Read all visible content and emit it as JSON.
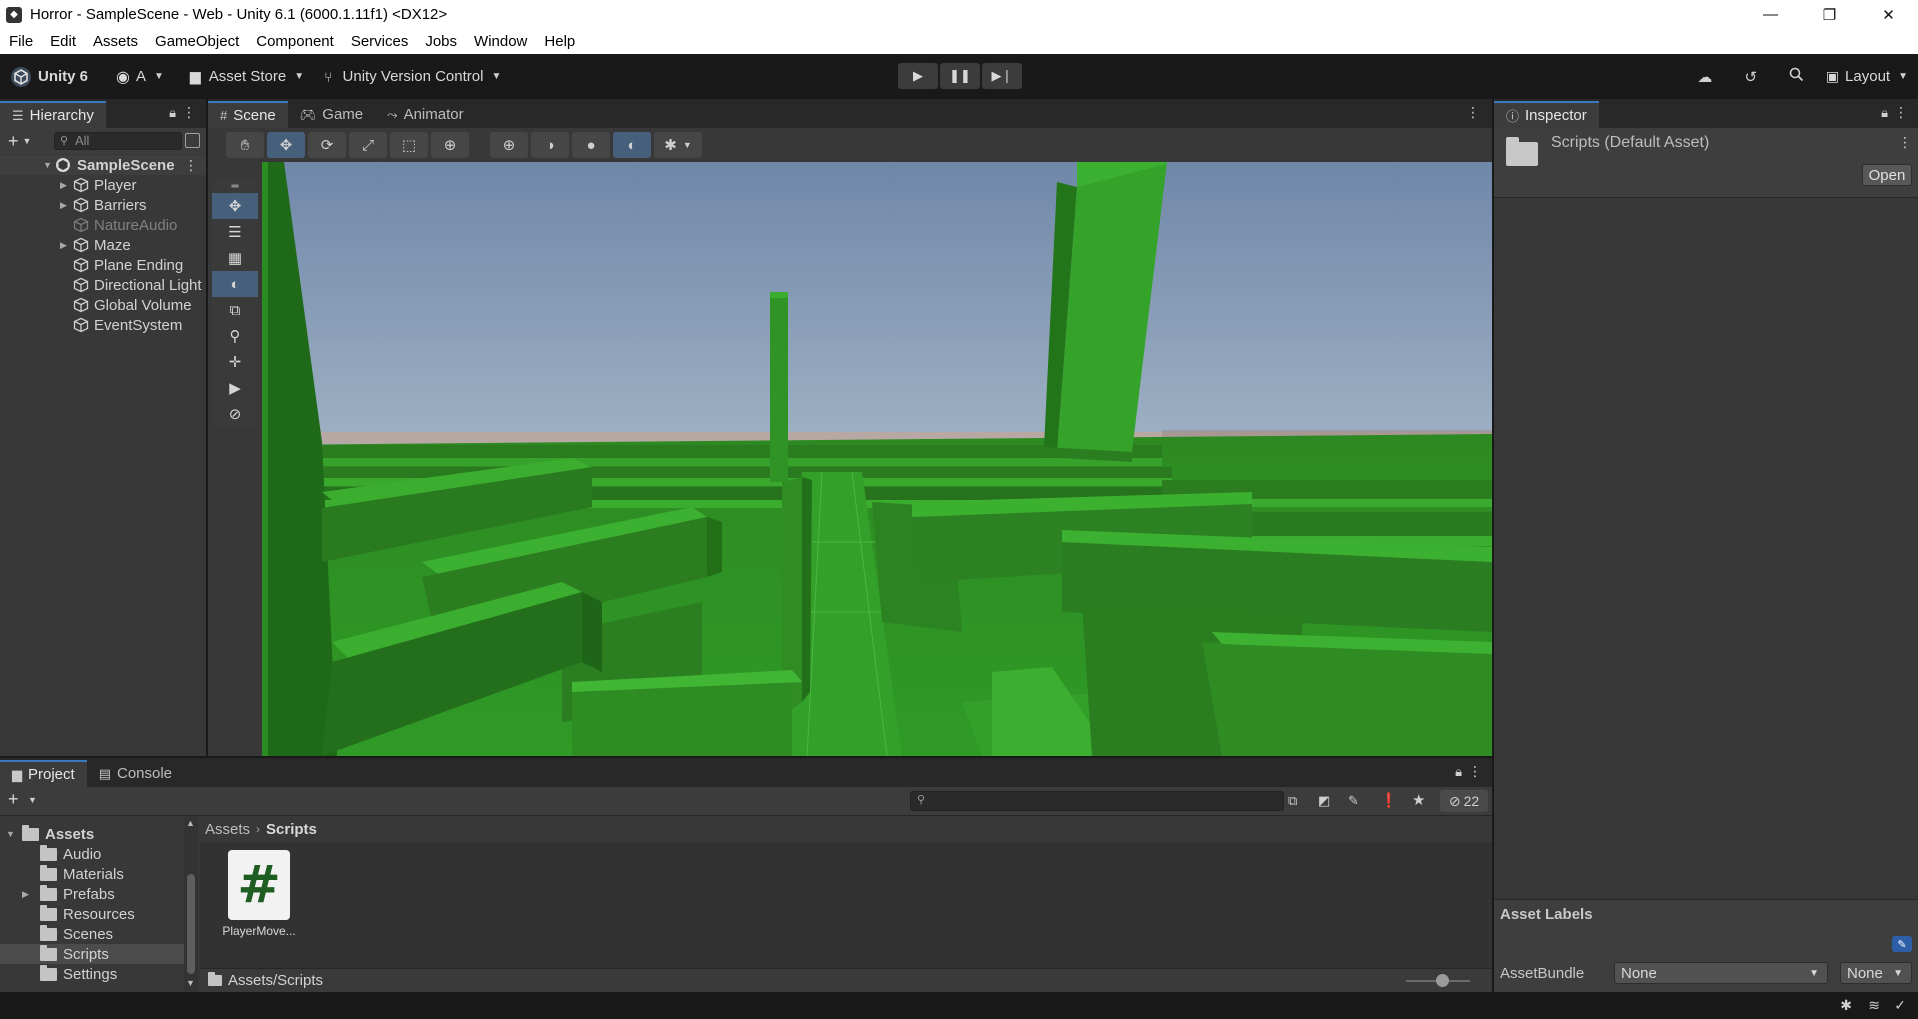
{
  "window": {
    "title": "Horror - SampleScene - Web - Unity 6.1 (6000.1.11f1) <DX12>",
    "minimize": "—",
    "maximize": "❐",
    "close": "✕"
  },
  "menu": [
    "File",
    "Edit",
    "Assets",
    "GameObject",
    "Component",
    "Services",
    "Jobs",
    "Window",
    "Help"
  ],
  "toolbar": {
    "unity_label": "Unity 6",
    "account_label": "A",
    "asset_store_label": "Asset Store",
    "version_control_label": "Unity Version Control",
    "layout_label": "Layout"
  },
  "hierarchy": {
    "tab_label": "Hierarchy",
    "search_placeholder": "All",
    "scene_name": "SampleScene",
    "items": [
      {
        "label": "Player",
        "expandable": true
      },
      {
        "label": "Barriers",
        "expandable": true
      },
      {
        "label": "NatureAudio",
        "expandable": false,
        "disabled": true
      },
      {
        "label": "Maze",
        "expandable": true
      },
      {
        "label": "Plane Ending",
        "expandable": false
      },
      {
        "label": "Directional Light",
        "expandable": false
      },
      {
        "label": "Global Volume",
        "expandable": false
      },
      {
        "label": "EventSystem",
        "expandable": false
      }
    ]
  },
  "scene": {
    "tabs": [
      {
        "label": "Scene",
        "icon": "grid-icon",
        "active": true
      },
      {
        "label": "Game",
        "icon": "gamepad-icon",
        "active": false
      },
      {
        "label": "Animator",
        "icon": "animator-icon",
        "active": false
      }
    ]
  },
  "inspector": {
    "tab_label": "Inspector",
    "asset_title": "Scripts (Default Asset)",
    "open_label": "Open",
    "asset_labels_heading": "Asset Labels",
    "asset_bundle_label": "AssetBundle",
    "asset_bundle_value": "None",
    "asset_bundle_variant": "None"
  },
  "project": {
    "tabs": [
      {
        "label": "Project",
        "icon": "folder-icon",
        "active": true
      },
      {
        "label": "Console",
        "icon": "console-icon",
        "active": false
      }
    ],
    "hidden_count": "22",
    "tree": {
      "root": "Assets",
      "folders": [
        {
          "label": "Audio",
          "expandable": false
        },
        {
          "label": "Materials",
          "expandable": false
        },
        {
          "label": "Prefabs",
          "expandable": true
        },
        {
          "label": "Resources",
          "expandable": false
        },
        {
          "label": "Scenes",
          "expandable": false
        },
        {
          "label": "Scripts",
          "expandable": false,
          "selected": true
        },
        {
          "label": "Settings",
          "expandable": false
        }
      ]
    },
    "breadcrumb": {
      "root": "Assets",
      "current": "Scripts"
    },
    "files": [
      {
        "label": "PlayerMove...",
        "icon": "csharp-script-icon"
      }
    ],
    "footer_path": "Assets/Scripts"
  }
}
